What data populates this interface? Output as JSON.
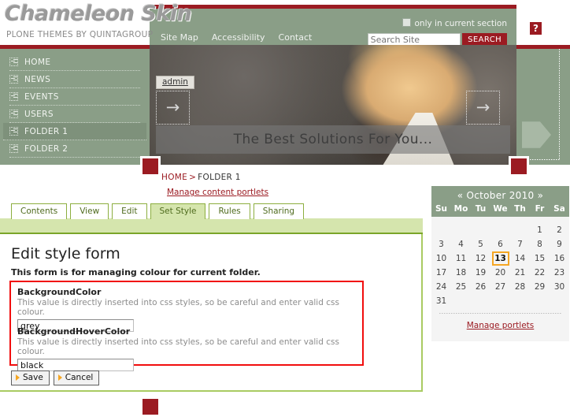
{
  "logo": {
    "title": "Chameleon Skin",
    "subtitle": "PLONE THEMES BY QUINTAGROUP"
  },
  "topbar": {
    "nav": [
      {
        "label": "Site Map"
      },
      {
        "label": "Accessibility"
      },
      {
        "label": "Contact"
      }
    ],
    "checkbox_label": "only in current section",
    "search_placeholder": "Search Site",
    "search_value": "",
    "search_button": "SEARCH",
    "help_icon": "?"
  },
  "sidebar": {
    "items": [
      {
        "label": "HOME",
        "icon": "arrow-box-icon",
        "active": false
      },
      {
        "label": "NEWS",
        "icon": "arrow-box-icon",
        "active": false
      },
      {
        "label": "EVENTS",
        "icon": "arrow-box-icon",
        "active": false
      },
      {
        "label": "USERS",
        "icon": "arrow-box-icon",
        "active": false
      },
      {
        "label": "FOLDER 1",
        "icon": "arrow-box-icon",
        "active": true
      },
      {
        "label": "FOLDER 2",
        "icon": "arrow-box-icon",
        "active": false
      }
    ]
  },
  "banner": {
    "admin_label": "admin",
    "prev_arrow": "→",
    "next_arrow": "→",
    "caption": "The Best Solutions For You..."
  },
  "breadcrumb": {
    "home": "HOME",
    "separator": ">",
    "current": "FOLDER 1",
    "manage_content_portlets": "Manage content portlets"
  },
  "tabs": [
    {
      "label": "Contents",
      "active": false
    },
    {
      "label": "View",
      "active": false
    },
    {
      "label": "Edit",
      "active": false
    },
    {
      "label": "Set Style",
      "active": true
    },
    {
      "label": "Rules",
      "active": false
    },
    {
      "label": "Sharing",
      "active": false
    }
  ],
  "form": {
    "title": "Edit style form",
    "description": "This form is for managing colour for current folder.",
    "fields": [
      {
        "label": "BackgroundColor",
        "help": "This value is directly inserted into css styles, so be careful and enter valid css colour.",
        "value": "grey"
      },
      {
        "label": "BackgroundHoverColor",
        "help": "This value is directly inserted into css styles, so be careful and enter valid css colour.",
        "value": "black"
      }
    ],
    "save_label": "Save",
    "cancel_label": "Cancel"
  },
  "calendar": {
    "prev": "«",
    "next": "»",
    "month_year": "October 2010",
    "weekdays": [
      "Su",
      "Mo",
      "Tu",
      "We",
      "Th",
      "Fr",
      "Sa"
    ],
    "weeks": [
      [
        "",
        "",
        "",
        "",
        "",
        "1",
        "2"
      ],
      [
        "3",
        "4",
        "5",
        "6",
        "7",
        "8",
        "9"
      ],
      [
        "10",
        "11",
        "12",
        "13",
        "14",
        "15",
        "16"
      ],
      [
        "17",
        "18",
        "19",
        "20",
        "21",
        "22",
        "23"
      ],
      [
        "24",
        "25",
        "26",
        "27",
        "28",
        "29",
        "30"
      ],
      [
        "31",
        "",
        "",
        "",
        "",
        "",
        ""
      ]
    ],
    "today": "13",
    "manage_portlets": "Manage portlets"
  },
  "colors": {
    "brand_red": "#9b1b22",
    "panel_green": "#8a9e87",
    "tab_green": "#8cae3f",
    "tab_active_bg": "#d5e5ad",
    "highlight_orange": "#f5a623",
    "fieldset_red": "#f10d0d"
  }
}
